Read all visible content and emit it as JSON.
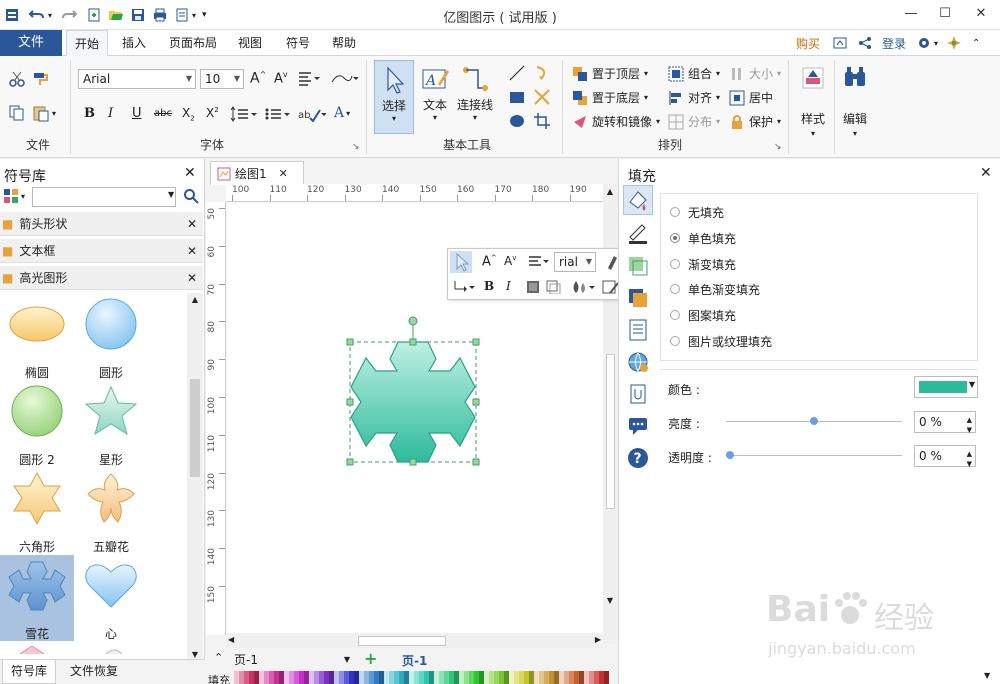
{
  "app": {
    "title": "亿图图示 ( 试用版 )"
  },
  "window": {
    "minimize": "—",
    "maximize": "☐",
    "close": "✕"
  },
  "menu": {
    "file": "文件",
    "tabs": [
      "开始",
      "插入",
      "页面布局",
      "视图",
      "符号",
      "帮助"
    ],
    "buy": "购买",
    "login": "登录"
  },
  "ribbon": {
    "font_name": "Arial",
    "font_size": "10",
    "groups": {
      "file": "文件",
      "font": "字体",
      "basic_tools": "基本工具",
      "arrange": "排列"
    },
    "tools": {
      "select": "选择",
      "text": "文本",
      "connector": "连接线"
    },
    "arrange": {
      "bring_front": "置于顶层",
      "send_back": "置于底层",
      "rotate_mirror": "旋转和镜像",
      "group": "组合",
      "align": "对齐",
      "distribute": "分布",
      "size": "大小",
      "center": "居中",
      "protect": "保护"
    },
    "style": "样式",
    "edit": "编辑"
  },
  "library": {
    "title": "符号库",
    "search_placeholder": "",
    "items": [
      "箭头形状",
      "文本框",
      "高光图形"
    ],
    "shapes": [
      "椭圆",
      "圆形",
      "圆形 2",
      "星形",
      "六角形",
      "五瓣花",
      "雪花",
      "心"
    ]
  },
  "canvas": {
    "tab": "绘图1",
    "hruler": [
      "100",
      "110",
      "120",
      "130",
      "140",
      "150",
      "160",
      "170",
      "180",
      "190"
    ],
    "vruler": [
      "50",
      "60",
      "70",
      "80",
      "90",
      "100",
      "110",
      "120",
      "130",
      "140",
      "150"
    ],
    "float_font": "rial"
  },
  "fill_panel": {
    "title": "填充",
    "options": [
      "无填充",
      "单色填充",
      "渐变填充",
      "单色渐变填充",
      "图案填充",
      "图片或纹理填充"
    ],
    "selected": "单色填充",
    "color_label": "颜色 :",
    "color": "#2dbb9b",
    "brightness_label": "亮度 :",
    "brightness_value": "0 %",
    "brightness": 0.5,
    "transparency_label": "透明度 :",
    "transparency_value": "0 %",
    "transparency": 0
  },
  "bottom": {
    "page_select": "页-1",
    "page_tab": "页-1",
    "fill_label": "填充",
    "tab_library": "符号库",
    "tab_recovery": "文件恢复"
  },
  "watermark": {
    "brand": "Bai",
    "suffix": "经验",
    "url": "jingyan.baidu.com"
  },
  "colors": {
    "accent": "#2b579a",
    "shape_teal": "#2dbb9b",
    "selected_shape_bg": "#a8c2e0"
  }
}
